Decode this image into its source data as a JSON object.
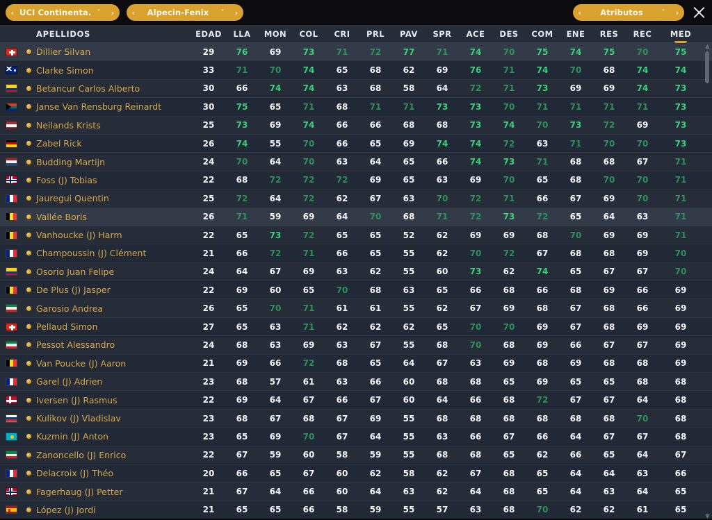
{
  "topbar": {
    "league_selector": {
      "label": "UCI Continenta..",
      "prev_icon": "‹",
      "caret_icon": "˅",
      "next_icon": "›"
    },
    "team_selector": {
      "label": "Alpecin-Fenix",
      "prev_icon": "‹",
      "caret_icon": "˅",
      "next_icon": "›"
    },
    "view_selector": {
      "label": "Atributos",
      "prev_icon": "‹",
      "caret_icon": "˅",
      "next_icon": "›"
    },
    "close_label": "×",
    "accent_color": "#d9a12e"
  },
  "table": {
    "columns": [
      {
        "key": "name",
        "label": "APELLIDOS"
      },
      {
        "key": "edad",
        "label": "EDAD"
      },
      {
        "key": "lla",
        "label": "LLA"
      },
      {
        "key": "mon",
        "label": "MON"
      },
      {
        "key": "col",
        "label": "COL"
      },
      {
        "key": "cri",
        "label": "CRI"
      },
      {
        "key": "prl",
        "label": "PRL"
      },
      {
        "key": "pav",
        "label": "PAV"
      },
      {
        "key": "spr",
        "label": "SPR"
      },
      {
        "key": "ace",
        "label": "ACE"
      },
      {
        "key": "des",
        "label": "DES"
      },
      {
        "key": "com",
        "label": "COM"
      },
      {
        "key": "ene",
        "label": "ENE"
      },
      {
        "key": "res",
        "label": "RES"
      },
      {
        "key": "rec",
        "label": "REC"
      },
      {
        "key": "med",
        "label": "MED"
      }
    ],
    "sorted_by": "MED",
    "sort_direction": "desc",
    "scrollbar": {
      "up_icon": "▲",
      "down_icon": "▼",
      "position_pct": 2
    },
    "rows": [
      {
        "flag": "ch",
        "status": "gold-dot",
        "name": "Dillier Silvan",
        "edad": 29,
        "lla": 76,
        "mon": 69,
        "col": 73,
        "cri": 71,
        "prl": 72,
        "pav": 77,
        "spr": 71,
        "ace": 74,
        "des": 70,
        "com": 75,
        "ene": 74,
        "res": 75,
        "rec": 70,
        "med": 75,
        "selected": true
      },
      {
        "flag": "au",
        "status": "gold-dot",
        "name": "Clarke Simon",
        "edad": 33,
        "lla": 71,
        "mon": 70,
        "col": 74,
        "cri": 65,
        "prl": 68,
        "pav": 62,
        "spr": 69,
        "ace": 76,
        "des": 71,
        "com": 74,
        "ene": 70,
        "res": 68,
        "rec": 74,
        "med": 74
      },
      {
        "flag": "co",
        "status": "gold-dot",
        "name": "Betancur Carlos Alberto",
        "edad": 30,
        "lla": 66,
        "mon": 74,
        "col": 74,
        "cri": 63,
        "prl": 68,
        "pav": 58,
        "spr": 64,
        "ace": 72,
        "des": 71,
        "com": 73,
        "ene": 69,
        "res": 69,
        "rec": 74,
        "med": 73
      },
      {
        "flag": "za",
        "status": "gold-dot",
        "name": "Janse Van Rensburg Reinardt",
        "edad": 30,
        "lla": 75,
        "mon": 65,
        "col": 71,
        "cri": 68,
        "prl": 71,
        "pav": 71,
        "spr": 73,
        "ace": 73,
        "des": 70,
        "com": 71,
        "ene": 71,
        "res": 71,
        "rec": 71,
        "med": 73
      },
      {
        "flag": "lv",
        "status": "gold-dot",
        "name": "Neilands Krists",
        "edad": 25,
        "lla": 73,
        "mon": 69,
        "col": 74,
        "cri": 66,
        "prl": 66,
        "pav": 68,
        "spr": 68,
        "ace": 73,
        "des": 74,
        "com": 70,
        "ene": 73,
        "res": 72,
        "rec": 69,
        "med": 73
      },
      {
        "flag": "de",
        "status": "gold-dot",
        "name": "Zabel Rick",
        "edad": 26,
        "lla": 74,
        "mon": 55,
        "col": 70,
        "cri": 66,
        "prl": 65,
        "pav": 69,
        "spr": 74,
        "ace": 74,
        "des": 72,
        "com": 63,
        "ene": 71,
        "res": 70,
        "rec": 70,
        "med": 73
      },
      {
        "flag": "nl",
        "status": "gold-dot",
        "name": "Budding Martijn",
        "edad": 24,
        "lla": 70,
        "mon": 64,
        "col": 70,
        "cri": 63,
        "prl": 64,
        "pav": 65,
        "spr": 66,
        "ace": 74,
        "des": 73,
        "com": 71,
        "ene": 68,
        "res": 68,
        "rec": 67,
        "med": 71
      },
      {
        "flag": "no",
        "status": "gold-dot",
        "name": "Foss (J) Tobias",
        "edad": 22,
        "lla": 68,
        "mon": 72,
        "col": 72,
        "cri": 72,
        "prl": 69,
        "pav": 65,
        "spr": 63,
        "ace": 69,
        "des": 70,
        "com": 65,
        "ene": 68,
        "res": 70,
        "rec": 70,
        "med": 71
      },
      {
        "flag": "fr",
        "status": "gold-dot",
        "name": "Jauregui Quentin",
        "edad": 25,
        "lla": 72,
        "mon": 64,
        "col": 72,
        "cri": 62,
        "prl": 67,
        "pav": 63,
        "spr": 70,
        "ace": 72,
        "des": 71,
        "com": 66,
        "ene": 67,
        "res": 69,
        "rec": 70,
        "med": 71
      },
      {
        "flag": "be",
        "status": "gold-dot",
        "name": "Vallée Boris",
        "edad": 26,
        "lla": 71,
        "mon": 59,
        "col": 69,
        "cri": 64,
        "prl": 70,
        "pav": 68,
        "spr": 71,
        "ace": 72,
        "des": 73,
        "com": 72,
        "ene": 65,
        "res": 64,
        "rec": 63,
        "med": 71,
        "hover": true
      },
      {
        "flag": "be",
        "status": "gold-dot",
        "name": "Vanhoucke (J) Harm",
        "edad": 22,
        "lla": 65,
        "mon": 73,
        "col": 72,
        "cri": 65,
        "prl": 65,
        "pav": 52,
        "spr": 62,
        "ace": 69,
        "des": 69,
        "com": 68,
        "ene": 70,
        "res": 69,
        "rec": 69,
        "med": 71
      },
      {
        "flag": "fr",
        "status": "gold-dot",
        "name": "Champoussin (J) Clément",
        "edad": 21,
        "lla": 66,
        "mon": 72,
        "col": 71,
        "cri": 66,
        "prl": 65,
        "pav": 55,
        "spr": 62,
        "ace": 70,
        "des": 72,
        "com": 67,
        "ene": 68,
        "res": 68,
        "rec": 69,
        "med": 70
      },
      {
        "flag": "co",
        "status": "gold-dot",
        "name": "Osorio Juan Felipe",
        "edad": 24,
        "lla": 64,
        "mon": 67,
        "col": 69,
        "cri": 63,
        "prl": 62,
        "pav": 55,
        "spr": 60,
        "ace": 73,
        "des": 62,
        "com": 74,
        "ene": 65,
        "res": 67,
        "rec": 67,
        "med": 70
      },
      {
        "flag": "be",
        "status": "gold-dot",
        "name": "De Plus (J) Jasper",
        "edad": 22,
        "lla": 69,
        "mon": 60,
        "col": 65,
        "cri": 70,
        "prl": 68,
        "pav": 63,
        "spr": 65,
        "ace": 66,
        "des": 68,
        "com": 66,
        "ene": 68,
        "res": 69,
        "rec": 66,
        "med": 69
      },
      {
        "flag": "it",
        "status": "gold-dot",
        "name": "Garosio Andrea",
        "edad": 26,
        "lla": 65,
        "mon": 70,
        "col": 71,
        "cri": 61,
        "prl": 61,
        "pav": 55,
        "spr": 62,
        "ace": 67,
        "des": 69,
        "com": 68,
        "ene": 67,
        "res": 68,
        "rec": 66,
        "med": 69
      },
      {
        "flag": "ch",
        "status": "gold-dot",
        "name": "Pellaud Simon",
        "edad": 27,
        "lla": 65,
        "mon": 63,
        "col": 71,
        "cri": 62,
        "prl": 62,
        "pav": 62,
        "spr": 65,
        "ace": 70,
        "des": 70,
        "com": 69,
        "ene": 67,
        "res": 68,
        "rec": 69,
        "med": 69
      },
      {
        "flag": "it",
        "status": "gold-dot",
        "name": "Pessot Alessandro",
        "edad": 24,
        "lla": 68,
        "mon": 63,
        "col": 69,
        "cri": 63,
        "prl": 67,
        "pav": 55,
        "spr": 68,
        "ace": 70,
        "des": 68,
        "com": 69,
        "ene": 66,
        "res": 67,
        "rec": 67,
        "med": 69
      },
      {
        "flag": "be",
        "status": "gold-dot",
        "name": "Van Poucke (J) Aaron",
        "edad": 21,
        "lla": 69,
        "mon": 66,
        "col": 72,
        "cri": 68,
        "prl": 65,
        "pav": 64,
        "spr": 67,
        "ace": 63,
        "des": 69,
        "com": 68,
        "ene": 69,
        "res": 68,
        "rec": 68,
        "med": 69
      },
      {
        "flag": "fr",
        "status": "gold-dot",
        "name": "Garel (J) Adrien",
        "edad": 23,
        "lla": 68,
        "mon": 57,
        "col": 61,
        "cri": 63,
        "prl": 66,
        "pav": 60,
        "spr": 68,
        "ace": 68,
        "des": 65,
        "com": 69,
        "ene": 65,
        "res": 65,
        "rec": 68,
        "med": 68
      },
      {
        "flag": "dk",
        "status": "gold-dot",
        "name": "Iversen (J) Rasmus",
        "edad": 22,
        "lla": 69,
        "mon": 64,
        "col": 67,
        "cri": 66,
        "prl": 67,
        "pav": 60,
        "spr": 64,
        "ace": 66,
        "des": 68,
        "com": 72,
        "ene": 67,
        "res": 67,
        "rec": 64,
        "med": 68
      },
      {
        "flag": "ru",
        "status": "gold-dot",
        "name": "Kulikov (J) Vladislav",
        "edad": 23,
        "lla": 68,
        "mon": 67,
        "col": 68,
        "cri": 67,
        "prl": 69,
        "pav": 55,
        "spr": 68,
        "ace": 68,
        "des": 68,
        "com": 68,
        "ene": 68,
        "res": 68,
        "rec": 70,
        "med": 68
      },
      {
        "flag": "kz",
        "status": "gold-dot",
        "name": "Kuzmin (J) Anton",
        "edad": 23,
        "lla": 65,
        "mon": 69,
        "col": 70,
        "cri": 67,
        "prl": 64,
        "pav": 55,
        "spr": 63,
        "ace": 66,
        "des": 67,
        "com": 66,
        "ene": 64,
        "res": 67,
        "rec": 67,
        "med": 68
      },
      {
        "flag": "it",
        "status": "gold-dot",
        "name": "Zanoncello (J) Enrico",
        "edad": 22,
        "lla": 67,
        "mon": 59,
        "col": 60,
        "cri": 58,
        "prl": 59,
        "pav": 55,
        "spr": 68,
        "ace": 68,
        "des": 65,
        "com": 62,
        "ene": 66,
        "res": 65,
        "rec": 64,
        "med": 67
      },
      {
        "flag": "fr",
        "status": "gold-dot",
        "name": "Delacroix (J) Théo",
        "edad": 20,
        "lla": 66,
        "mon": 65,
        "col": 67,
        "cri": 60,
        "prl": 62,
        "pav": 58,
        "spr": 62,
        "ace": 67,
        "des": 68,
        "com": 65,
        "ene": 64,
        "res": 64,
        "rec": 63,
        "med": 66
      },
      {
        "flag": "no",
        "status": "gold-dot",
        "name": "Fagerhaug (J) Petter",
        "edad": 21,
        "lla": 67,
        "mon": 64,
        "col": 66,
        "cri": 60,
        "prl": 64,
        "pav": 63,
        "spr": 62,
        "ace": 64,
        "des": 68,
        "com": 65,
        "ene": 64,
        "res": 63,
        "rec": 64,
        "med": 65
      },
      {
        "flag": "es",
        "status": "gold-dot",
        "name": "López (J) Jordi",
        "edad": 21,
        "lla": 65,
        "mon": 65,
        "col": 66,
        "cri": 58,
        "prl": 59,
        "pav": 55,
        "spr": 57,
        "ace": 63,
        "des": 68,
        "com": 70,
        "ene": 62,
        "res": 62,
        "rec": 61,
        "med": 65
      }
    ]
  },
  "value_tiers": {
    "high_color": "#3ccf7a",
    "mid_color": "#2f8f5b",
    "low_color": "#f2f4f7",
    "high_min": 73,
    "mid_min": 70
  }
}
